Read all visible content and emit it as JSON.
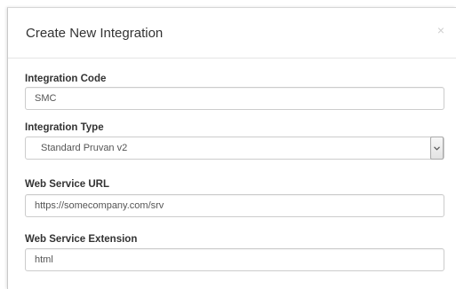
{
  "dialog": {
    "title": "Create New Integration",
    "close_symbol": "×"
  },
  "fields": {
    "integration_code": {
      "label": "Integration Code",
      "value": "SMC"
    },
    "integration_type": {
      "label": "Integration Type",
      "selected": "Standard Pruvan v2",
      "icon": "chevron-down-icon"
    },
    "web_service_url": {
      "label": "Web Service URL",
      "value": "https://somecompany.com/srv"
    },
    "web_service_extension": {
      "label": "Web Service Extension",
      "value": "html"
    }
  }
}
